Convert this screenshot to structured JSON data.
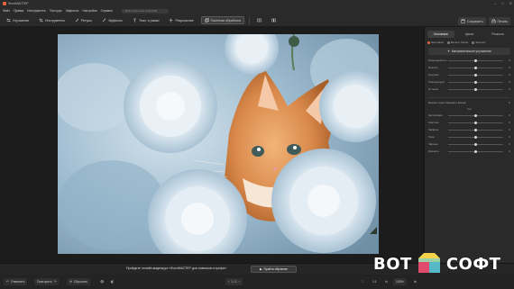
{
  "window": {
    "title": "ФотоМАСТЕР",
    "controls": [
      "–",
      "□",
      "✕"
    ]
  },
  "menu": {
    "items": [
      "Файл",
      "Правка",
      "Инструменты",
      "Текстура",
      "Эффекты",
      "Настройки",
      "Справка"
    ],
    "search_placeholder": "Быстрый поиск действий"
  },
  "toolbar": {
    "items": [
      {
        "label": "Улучшения",
        "icon": "sliders-icon"
      },
      {
        "label": "Инструменты",
        "icon": "crop-icon"
      },
      {
        "label": "Ретушь",
        "icon": "brush-icon"
      },
      {
        "label": "Эффекты",
        "icon": "wand-icon"
      },
      {
        "label": "Текст и рамки",
        "icon": "text-icon"
      },
      {
        "label": "Разрешение",
        "icon": "plus-icon"
      },
      {
        "label": "Пакетная обработка",
        "icon": "stack-icon"
      }
    ],
    "save_label": "Сохранить",
    "print_label": "Печать"
  },
  "panel": {
    "tabs": [
      "Основные",
      "Цвета",
      "Резкость"
    ],
    "chips": [
      "Цветовой",
      "Фильтр бокса",
      "Экспорт"
    ],
    "auto_button": "Автоматическое улучшение",
    "sliders_a": [
      {
        "label": "Насыщенность",
        "value": "0",
        "pos": 0.5
      },
      {
        "label": "Яркость",
        "value": "0",
        "pos": 0.5
      },
      {
        "label": "Контраст",
        "value": "0",
        "pos": 0.5
      },
      {
        "label": "Температура",
        "value": "0",
        "pos": 0.5
      },
      {
        "label": "Оттенок",
        "value": "0",
        "pos": 0.5
      }
    ],
    "balance_label": "Баланс через Замерить Белый",
    "balance_hint": "Тон",
    "sliders_b": [
      {
        "label": "Экспозиция",
        "value": "0",
        "pos": 0.5
      },
      {
        "label": "Светлые",
        "value": "0",
        "pos": 0.5
      },
      {
        "label": "Засветы",
        "value": "0",
        "pos": 0.5
      },
      {
        "label": "Тени",
        "value": "0",
        "pos": 0.5
      },
      {
        "label": "Чёрные",
        "value": "0",
        "pos": 0.5
      },
      {
        "label": "Резкость",
        "value": "0",
        "pos": 0.5
      }
    ]
  },
  "promo": {
    "text": "Пройдите онлайн-видеокурс «ФотоМАСТЕР для новичков и профи»",
    "button": "Пройти обучение"
  },
  "status": {
    "undo": "Отменить",
    "redo": "Повторить",
    "reset": "Сбросить",
    "page": "1 / 1",
    "zoom": "1:1",
    "zoom_pct": "100%"
  },
  "watermark": {
    "left": "ВОТ",
    "right": "СОФТ"
  },
  "colors": {
    "accent": "#e8643c"
  }
}
